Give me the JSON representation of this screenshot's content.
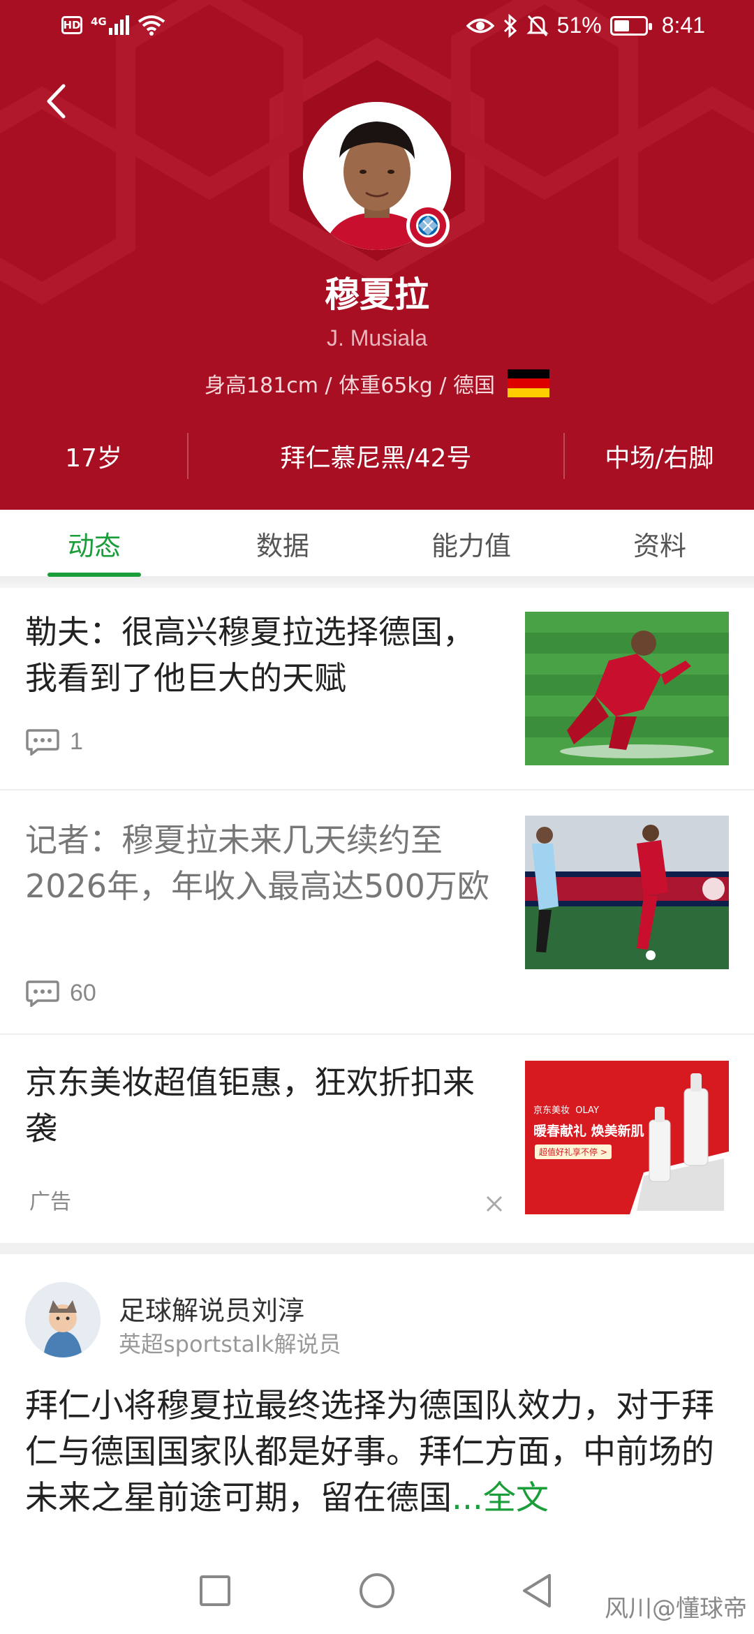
{
  "status_bar": {
    "hd": "HD",
    "network": "4G",
    "battery_text": "51%",
    "battery_level": 0.51,
    "time": "8:41",
    "icons": [
      "signal-icon",
      "wifi-icon",
      "eye-icon",
      "bluetooth-icon",
      "mute-icon",
      "battery-icon"
    ]
  },
  "player": {
    "name": "穆夏拉",
    "en_name": "J. Musiala",
    "body_info": "身高181cm / 体重65kg / 德国",
    "age": "17岁",
    "team": "拜仁慕尼黑/42号",
    "position": "中场/右脚"
  },
  "colors": {
    "header": "#A80F22",
    "accent": "#1a9e3a"
  },
  "tabs": [
    {
      "label": "动态",
      "active": true
    },
    {
      "label": "数据",
      "active": false
    },
    {
      "label": "能力值",
      "active": false
    },
    {
      "label": "资料",
      "active": false
    }
  ],
  "news": [
    {
      "title": "勒夫：很高兴穆夏拉选择德国，我看到了他巨大的天赋",
      "comments": "1"
    },
    {
      "title": "记者：穆夏拉未来几天续约至2026年，年收入最高达500万欧",
      "comments": "60"
    }
  ],
  "ad": {
    "title": "京东美妆超值钜惠，狂欢折扣来袭",
    "label": "广告",
    "image_text": {
      "brand": "京东美妆",
      "brand2": "OLAY",
      "headline": "暖春献礼 焕美新肌",
      "button": "超值好礼享不停 >"
    }
  },
  "post": {
    "author": "足球解说员刘淳",
    "subtitle": "英超sportstalk解说员",
    "body": "拜仁小将穆夏拉最终选择为德国队效力，对于拜仁与德国国家队都是好事。拜仁方面，中前场的未来之星前途可期，留在德国",
    "read_more": "...全文"
  },
  "watermark": "风川@懂球帝"
}
